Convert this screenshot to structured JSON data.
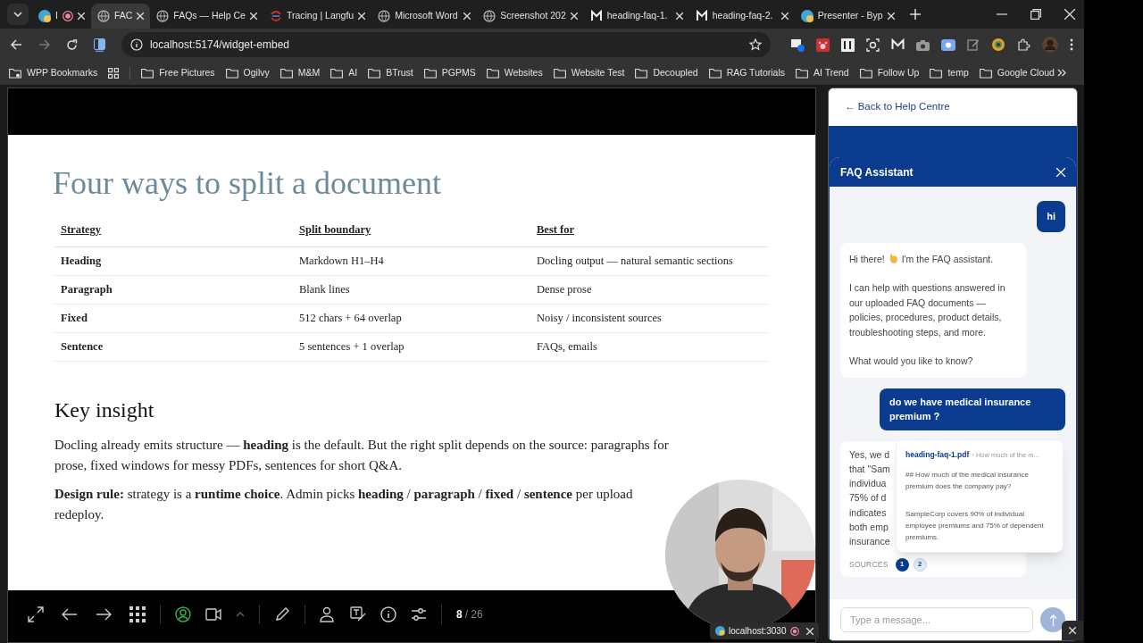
{
  "browser": {
    "tabs": [
      {
        "kind": "app",
        "title": "I",
        "recording": true,
        "selected": false
      },
      {
        "kind": "globe",
        "title": "FAC",
        "recording": false,
        "selected": true
      },
      {
        "kind": "globe",
        "title": "FAQs — Help Ce",
        "recording": false,
        "selected": false
      },
      {
        "kind": "tracing",
        "title": "Tracing | Langfu",
        "recording": false,
        "selected": false
      },
      {
        "kind": "globe",
        "title": "Microsoft Word",
        "recording": false,
        "selected": false
      },
      {
        "kind": "globe",
        "title": "Screenshot 202",
        "recording": false,
        "selected": false
      },
      {
        "kind": "m",
        "title": "heading-faq-1.",
        "recording": false,
        "selected": false
      },
      {
        "kind": "m",
        "title": "heading-faq-2.",
        "recording": false,
        "selected": false
      },
      {
        "kind": "app",
        "title": "Presenter - Byp",
        "recording": false,
        "selected": false
      }
    ],
    "address": "localhost:5174/widget-embed",
    "bookmarks": [
      {
        "kind": "special",
        "label": "WPP Bookmarks"
      },
      {
        "kind": "apps"
      },
      {
        "kind": "folder",
        "label": "Free Pictures"
      },
      {
        "kind": "folder",
        "label": "Ogilvy"
      },
      {
        "kind": "folder",
        "label": "M&M"
      },
      {
        "kind": "folder",
        "label": "AI"
      },
      {
        "kind": "folder",
        "label": "BTrust"
      },
      {
        "kind": "folder",
        "label": "PGPMS"
      },
      {
        "kind": "folder",
        "label": "Websites"
      },
      {
        "kind": "folder",
        "label": "Website Test"
      },
      {
        "kind": "folder",
        "label": "Decoupled"
      },
      {
        "kind": "folder",
        "label": "RAG Tutorials"
      },
      {
        "kind": "folder",
        "label": "AI Trend"
      },
      {
        "kind": "folder",
        "label": "Follow Up"
      },
      {
        "kind": "folder",
        "label": "temp"
      },
      {
        "kind": "folder",
        "label": "Google Cloud"
      }
    ]
  },
  "slide": {
    "title": "Four ways to split a document",
    "table": {
      "columns": [
        "Strategy",
        "Split boundary",
        "Best for"
      ],
      "rows": [
        [
          "Heading",
          "Markdown H1–H4",
          "Docling output — natural semantic sections"
        ],
        [
          "Paragraph",
          "Blank lines",
          "Dense prose"
        ],
        [
          "Fixed",
          "512 chars + 64 overlap",
          "Noisy / inconsistent sources"
        ],
        [
          "Sentence",
          "5 sentences + 1 overlap",
          "FAQs, emails"
        ]
      ]
    },
    "insight_heading": "Key insight",
    "paragraphs": [
      [
        "Docling already emits structure — **heading** is the default. But the right split depends on the source: paragraphs for",
        "prose, fixed windows for messy PDFs, sentences for short Q&A."
      ],
      [
        "**Design rule:** strategy is a **runtime choice**. Admin picks **heading** / **paragraph** / **fixed** / **sentence** per upload",
        "redeploy."
      ]
    ],
    "webcam": {
      "kind": "picture"
    },
    "counter": {
      "current": "8",
      "total": "/ 26"
    }
  },
  "notification": {
    "label": "localhost:3030"
  },
  "chat": {
    "back_link": "← Back to Help Centre",
    "title": "FAQ Assistant",
    "messages": [
      {
        "kind": "user",
        "text": "hi"
      },
      {
        "kind": "greeting",
        "greeting": [
          "Hi there!",
          "I'm the FAQ assistant."
        ],
        "paragraphs": [
          "I can help with questions answered in our uploaded FAQ documents — policies, procedures, product details, troubleshooting steps, and more.",
          "What would you like to know?"
        ]
      },
      {
        "kind": "user",
        "text": "do we have  medical insurance premium ?"
      },
      {
        "kind": "answer",
        "lines": [
          "Yes, we d",
          "that \"Sam",
          "individua",
          "75% of d",
          "indicates",
          "both emp",
          "insurance"
        ],
        "sources_label": "SOURCES",
        "sources": [
          {
            "label": "1",
            "selected": true
          },
          {
            "label": "2",
            "selected": false
          }
        ],
        "popover": {
          "file": "heading-faq-1.pdf",
          "crumb": "› How much of the m...",
          "heading": "## How much of the medical insurance premium does the company pay?",
          "body": "SampleCorp covers 90% of individual employee premiums and 75% of dependent premiums."
        }
      }
    ],
    "input": {
      "placeholder": "Type a message..."
    }
  }
}
